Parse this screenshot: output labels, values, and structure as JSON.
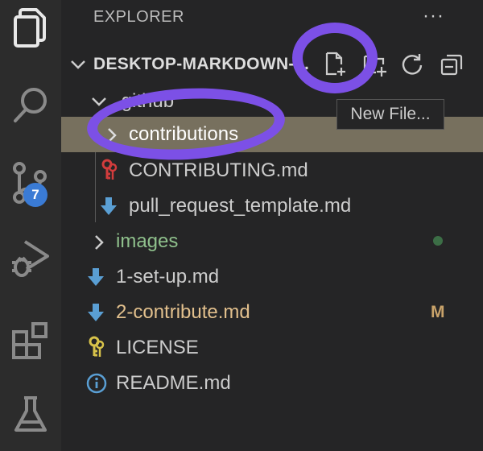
{
  "activity_bar": {
    "icons": [
      "explorer-icon",
      "search-icon",
      "source-control-icon",
      "run-debug-icon",
      "extensions-icon",
      "testing-icon"
    ],
    "source_control_badge": "7"
  },
  "sidebar": {
    "header": "EXPLORER",
    "more": "···",
    "folder_title": "DESKTOP-MARKDOWN-...",
    "toolbar": [
      "new-file-icon",
      "new-folder-icon",
      "refresh-icon",
      "collapse-all-icon"
    ],
    "tooltip": "New File...",
    "tree": [
      {
        "label": ".github",
        "type": "folder",
        "expanded": true
      },
      {
        "label": "contributions",
        "type": "folder",
        "expanded": false,
        "selected": true
      },
      {
        "label": "CONTRIBUTING.md",
        "type": "file"
      },
      {
        "label": "pull_request_template.md",
        "type": "file"
      },
      {
        "label": "images",
        "type": "folder",
        "expanded": false
      },
      {
        "label": "1-set-up.md",
        "type": "file"
      },
      {
        "label": "2-contribute.md",
        "type": "file",
        "status": "M"
      },
      {
        "label": "LICENSE",
        "type": "file"
      },
      {
        "label": "README.md",
        "type": "file"
      }
    ]
  },
  "colors": {
    "selection": "#77705e",
    "annotation": "#7c50e6",
    "badge": "#3a7bd5",
    "images_text": "#8fc08c",
    "modified_text": "#e2c08d"
  }
}
